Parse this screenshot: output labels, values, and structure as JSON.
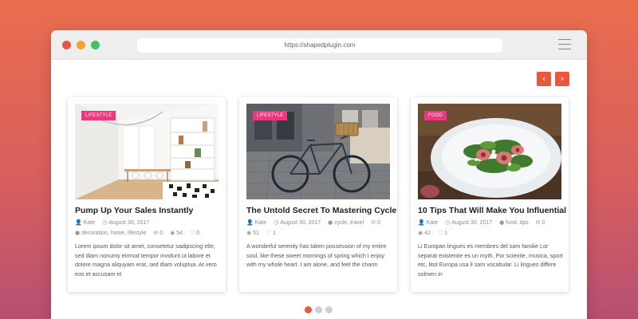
{
  "browser": {
    "url": "https://shapedplugin.com"
  },
  "carousel": {
    "prev_icon": "chevron-left",
    "next_icon": "chevron-right",
    "accent": "#e8573e",
    "pagination": {
      "count": 3,
      "active": 1
    }
  },
  "posts": [
    {
      "category": "LIFESTYLE",
      "title": "Pump Up Your Sales Instantly",
      "author": "Kate",
      "date": "August 30, 2017",
      "comments": "0",
      "views": "54",
      "likes": "0",
      "tags": "decoration, home, lifestyle",
      "excerpt": "Lorem ipsum dolor sit amet, consetetur sadipscing elitr, sed diam nonumy eirmod tempor invidunt ut labore et dolore magna aliquyam erat, sed diam voluptua. At vero eos et accusam et"
    },
    {
      "category": "LIFESTYLE",
      "title": "The Untold Secret To Mastering Cycle",
      "author": "Kate",
      "date": "August 30, 2017",
      "comments": "0",
      "views": "51",
      "likes": "1",
      "tags": "cycle, travel",
      "excerpt": "A wonderful serenity has taken possession of my entire soul, like these sweet mornings of spring which I enjoy with my whole heart. I am alone, and feel the charm"
    },
    {
      "category": "FOOD",
      "title": "10 Tips That Will Make You Influential",
      "author": "Kate",
      "date": "August 30, 2017",
      "comments": "0",
      "views": "42",
      "likes": "1",
      "tags": "food, tips",
      "excerpt": "Li Europan lingues es membres del sam familie Lor separat existentie es un myth. Por scientie, musica, sport etc, litot Europa usa li sam vocabular. Li lingues differe solmen in"
    }
  ]
}
